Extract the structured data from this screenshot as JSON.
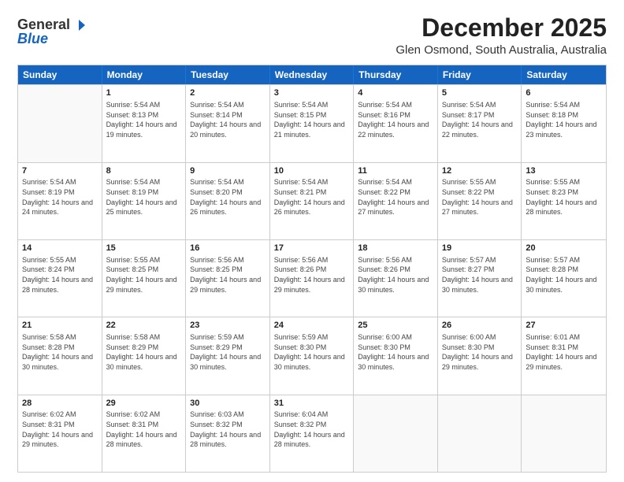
{
  "logo": {
    "general": "General",
    "blue": "Blue"
  },
  "header": {
    "month": "December 2025",
    "location": "Glen Osmond, South Australia, Australia"
  },
  "weekdays": [
    "Sunday",
    "Monday",
    "Tuesday",
    "Wednesday",
    "Thursday",
    "Friday",
    "Saturday"
  ],
  "weeks": [
    [
      {
        "day": "",
        "sunrise": "",
        "sunset": "",
        "daylight": ""
      },
      {
        "day": "1",
        "sunrise": "Sunrise: 5:54 AM",
        "sunset": "Sunset: 8:13 PM",
        "daylight": "Daylight: 14 hours and 19 minutes."
      },
      {
        "day": "2",
        "sunrise": "Sunrise: 5:54 AM",
        "sunset": "Sunset: 8:14 PM",
        "daylight": "Daylight: 14 hours and 20 minutes."
      },
      {
        "day": "3",
        "sunrise": "Sunrise: 5:54 AM",
        "sunset": "Sunset: 8:15 PM",
        "daylight": "Daylight: 14 hours and 21 minutes."
      },
      {
        "day": "4",
        "sunrise": "Sunrise: 5:54 AM",
        "sunset": "Sunset: 8:16 PM",
        "daylight": "Daylight: 14 hours and 22 minutes."
      },
      {
        "day": "5",
        "sunrise": "Sunrise: 5:54 AM",
        "sunset": "Sunset: 8:17 PM",
        "daylight": "Daylight: 14 hours and 22 minutes."
      },
      {
        "day": "6",
        "sunrise": "Sunrise: 5:54 AM",
        "sunset": "Sunset: 8:18 PM",
        "daylight": "Daylight: 14 hours and 23 minutes."
      }
    ],
    [
      {
        "day": "7",
        "sunrise": "Sunrise: 5:54 AM",
        "sunset": "Sunset: 8:19 PM",
        "daylight": "Daylight: 14 hours and 24 minutes."
      },
      {
        "day": "8",
        "sunrise": "Sunrise: 5:54 AM",
        "sunset": "Sunset: 8:19 PM",
        "daylight": "Daylight: 14 hours and 25 minutes."
      },
      {
        "day": "9",
        "sunrise": "Sunrise: 5:54 AM",
        "sunset": "Sunset: 8:20 PM",
        "daylight": "Daylight: 14 hours and 26 minutes."
      },
      {
        "day": "10",
        "sunrise": "Sunrise: 5:54 AM",
        "sunset": "Sunset: 8:21 PM",
        "daylight": "Daylight: 14 hours and 26 minutes."
      },
      {
        "day": "11",
        "sunrise": "Sunrise: 5:54 AM",
        "sunset": "Sunset: 8:22 PM",
        "daylight": "Daylight: 14 hours and 27 minutes."
      },
      {
        "day": "12",
        "sunrise": "Sunrise: 5:55 AM",
        "sunset": "Sunset: 8:22 PM",
        "daylight": "Daylight: 14 hours and 27 minutes."
      },
      {
        "day": "13",
        "sunrise": "Sunrise: 5:55 AM",
        "sunset": "Sunset: 8:23 PM",
        "daylight": "Daylight: 14 hours and 28 minutes."
      }
    ],
    [
      {
        "day": "14",
        "sunrise": "Sunrise: 5:55 AM",
        "sunset": "Sunset: 8:24 PM",
        "daylight": "Daylight: 14 hours and 28 minutes."
      },
      {
        "day": "15",
        "sunrise": "Sunrise: 5:55 AM",
        "sunset": "Sunset: 8:25 PM",
        "daylight": "Daylight: 14 hours and 29 minutes."
      },
      {
        "day": "16",
        "sunrise": "Sunrise: 5:56 AM",
        "sunset": "Sunset: 8:25 PM",
        "daylight": "Daylight: 14 hours and 29 minutes."
      },
      {
        "day": "17",
        "sunrise": "Sunrise: 5:56 AM",
        "sunset": "Sunset: 8:26 PM",
        "daylight": "Daylight: 14 hours and 29 minutes."
      },
      {
        "day": "18",
        "sunrise": "Sunrise: 5:56 AM",
        "sunset": "Sunset: 8:26 PM",
        "daylight": "Daylight: 14 hours and 30 minutes."
      },
      {
        "day": "19",
        "sunrise": "Sunrise: 5:57 AM",
        "sunset": "Sunset: 8:27 PM",
        "daylight": "Daylight: 14 hours and 30 minutes."
      },
      {
        "day": "20",
        "sunrise": "Sunrise: 5:57 AM",
        "sunset": "Sunset: 8:28 PM",
        "daylight": "Daylight: 14 hours and 30 minutes."
      }
    ],
    [
      {
        "day": "21",
        "sunrise": "Sunrise: 5:58 AM",
        "sunset": "Sunset: 8:28 PM",
        "daylight": "Daylight: 14 hours and 30 minutes."
      },
      {
        "day": "22",
        "sunrise": "Sunrise: 5:58 AM",
        "sunset": "Sunset: 8:29 PM",
        "daylight": "Daylight: 14 hours and 30 minutes."
      },
      {
        "day": "23",
        "sunrise": "Sunrise: 5:59 AM",
        "sunset": "Sunset: 8:29 PM",
        "daylight": "Daylight: 14 hours and 30 minutes."
      },
      {
        "day": "24",
        "sunrise": "Sunrise: 5:59 AM",
        "sunset": "Sunset: 8:30 PM",
        "daylight": "Daylight: 14 hours and 30 minutes."
      },
      {
        "day": "25",
        "sunrise": "Sunrise: 6:00 AM",
        "sunset": "Sunset: 8:30 PM",
        "daylight": "Daylight: 14 hours and 30 minutes."
      },
      {
        "day": "26",
        "sunrise": "Sunrise: 6:00 AM",
        "sunset": "Sunset: 8:30 PM",
        "daylight": "Daylight: 14 hours and 29 minutes."
      },
      {
        "day": "27",
        "sunrise": "Sunrise: 6:01 AM",
        "sunset": "Sunset: 8:31 PM",
        "daylight": "Daylight: 14 hours and 29 minutes."
      }
    ],
    [
      {
        "day": "28",
        "sunrise": "Sunrise: 6:02 AM",
        "sunset": "Sunset: 8:31 PM",
        "daylight": "Daylight: 14 hours and 29 minutes."
      },
      {
        "day": "29",
        "sunrise": "Sunrise: 6:02 AM",
        "sunset": "Sunset: 8:31 PM",
        "daylight": "Daylight: 14 hours and 28 minutes."
      },
      {
        "day": "30",
        "sunrise": "Sunrise: 6:03 AM",
        "sunset": "Sunset: 8:32 PM",
        "daylight": "Daylight: 14 hours and 28 minutes."
      },
      {
        "day": "31",
        "sunrise": "Sunrise: 6:04 AM",
        "sunset": "Sunset: 8:32 PM",
        "daylight": "Daylight: 14 hours and 28 minutes."
      },
      {
        "day": "",
        "sunrise": "",
        "sunset": "",
        "daylight": ""
      },
      {
        "day": "",
        "sunrise": "",
        "sunset": "",
        "daylight": ""
      },
      {
        "day": "",
        "sunrise": "",
        "sunset": "",
        "daylight": ""
      }
    ]
  ]
}
